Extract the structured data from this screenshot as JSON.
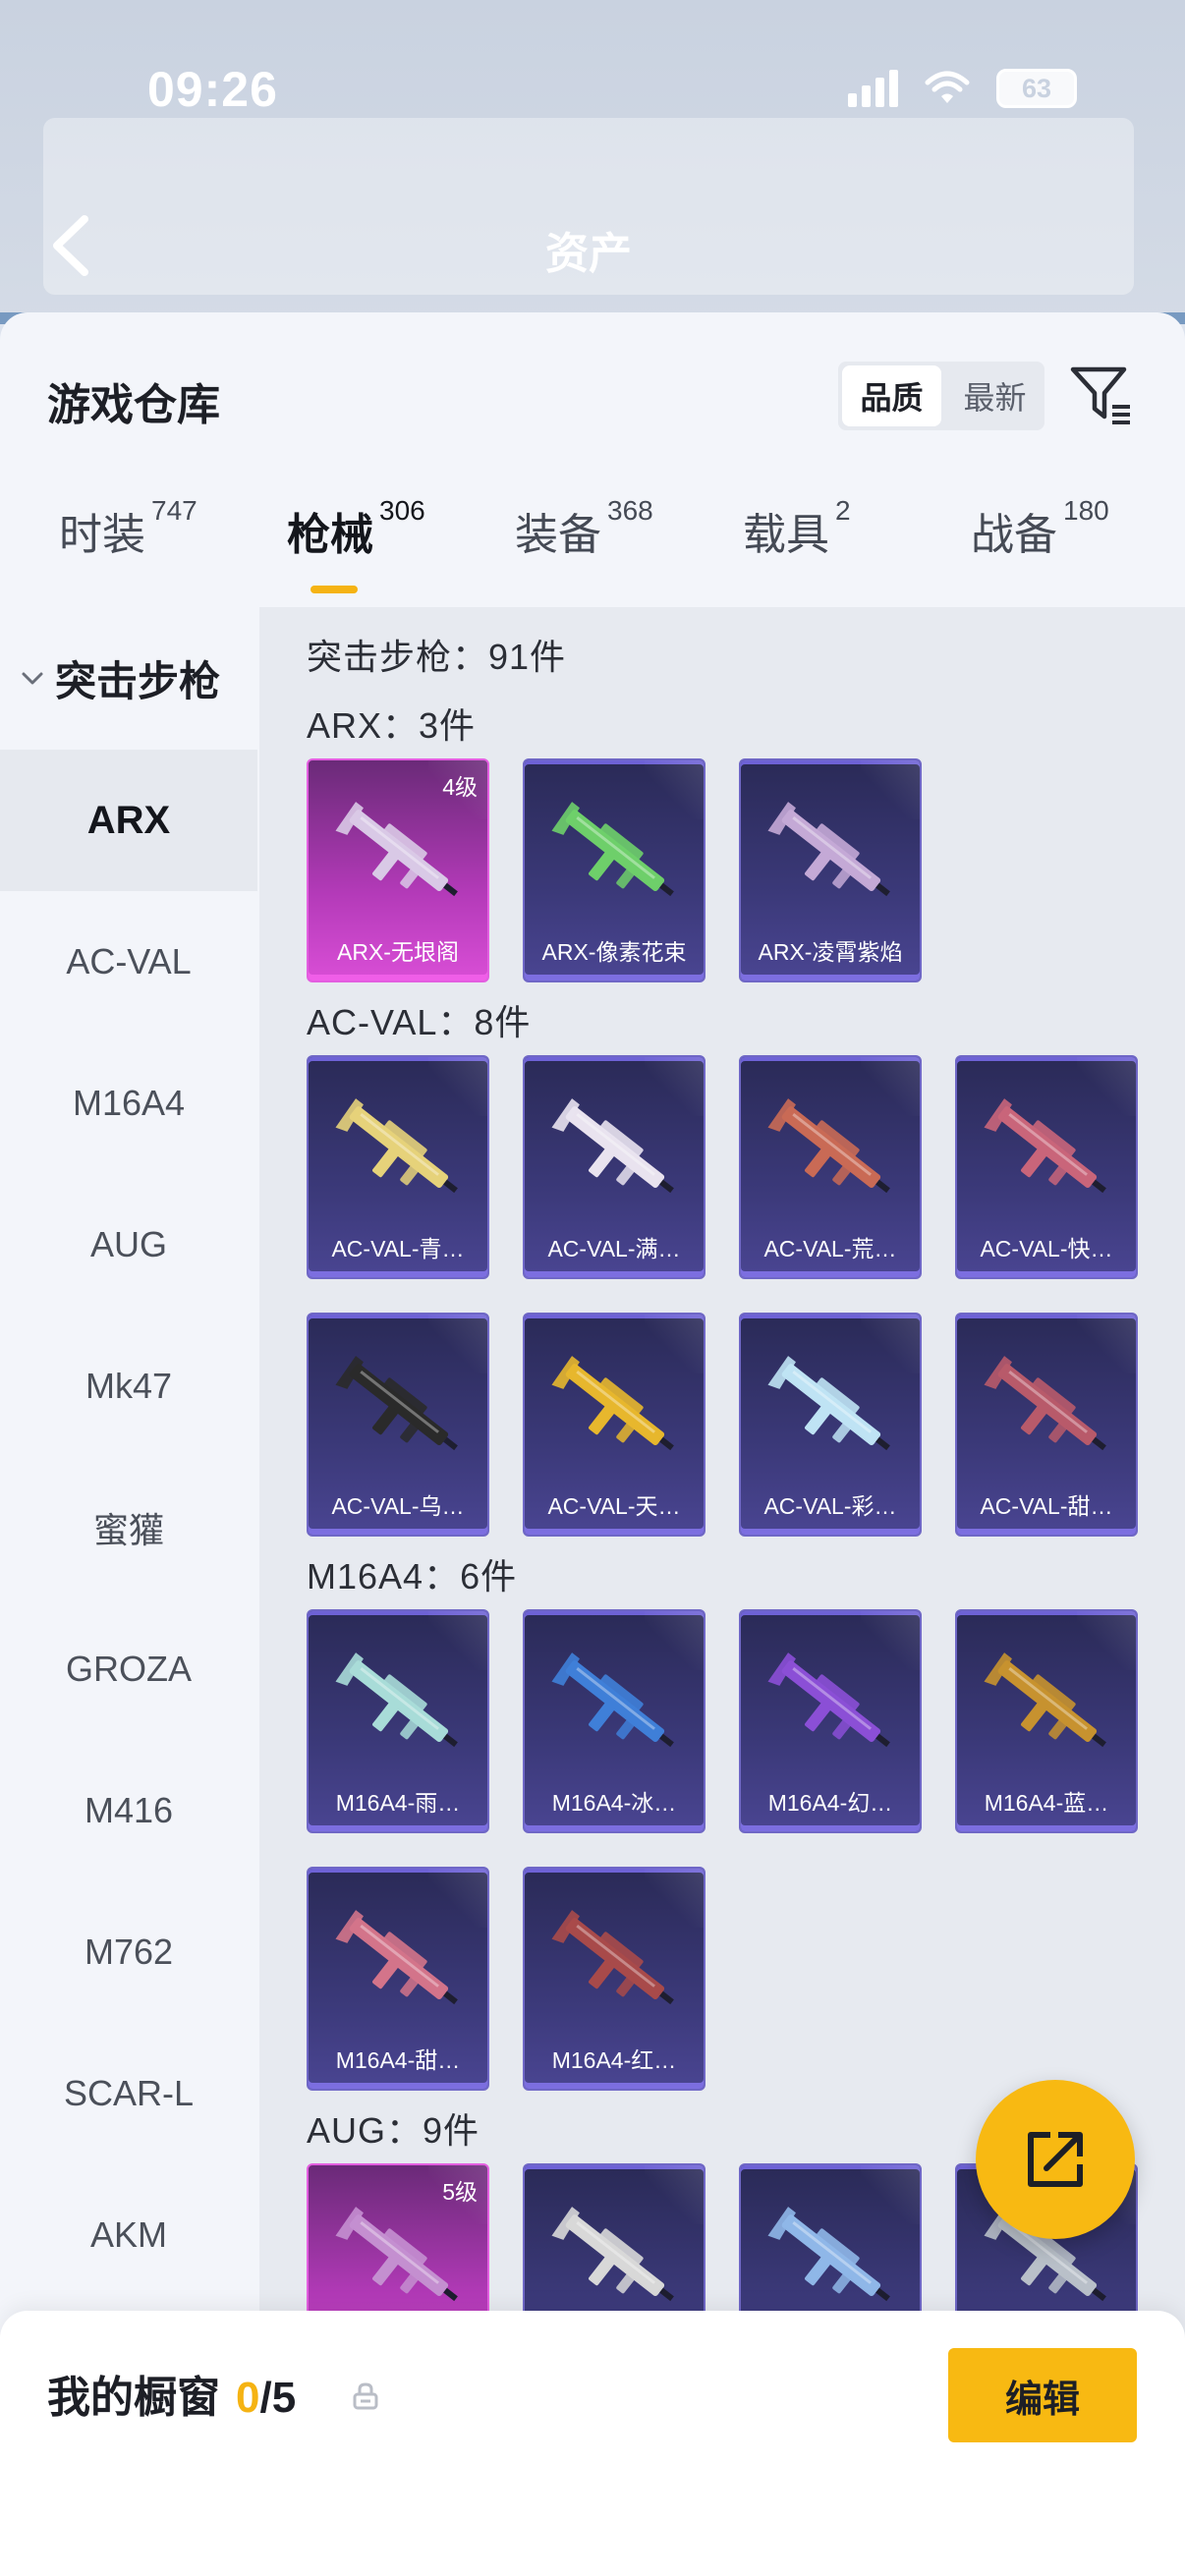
{
  "status_bar": {
    "time": "09:26",
    "battery": "63"
  },
  "header": {
    "title": "资产"
  },
  "sheet": {
    "title": "游戏仓库",
    "sort": [
      {
        "label": "品质",
        "active": true
      },
      {
        "label": "最新",
        "active": false
      }
    ]
  },
  "tabs": [
    {
      "label": "时装",
      "count": "747"
    },
    {
      "label": "枪械",
      "count": "306"
    },
    {
      "label": "装备",
      "count": "368"
    },
    {
      "label": "载具",
      "count": "2"
    },
    {
      "label": "战备",
      "count": "180"
    }
  ],
  "sidebar": {
    "category": "突击步枪",
    "items": [
      "ARX",
      "AC-VAL",
      "M16A4",
      "AUG",
      "Mk47",
      "蜜獾",
      "GROZA",
      "M416",
      "M762",
      "SCAR-L",
      "AKM"
    ]
  },
  "content": {
    "category_total": "突击步枪：91件",
    "sections": [
      {
        "title": "ARX：3件",
        "items": [
          {
            "name": "ARX-无垠阁",
            "level": "4级",
            "rarity": "legendary",
            "color": "#d9c9e6"
          },
          {
            "name": "ARX-像素花束",
            "level": "",
            "rarity": "epic",
            "color": "#6ecf6a"
          },
          {
            "name": "ARX-凌霄紫焰",
            "level": "",
            "rarity": "epic",
            "color": "#c4a9d6"
          }
        ]
      },
      {
        "title": "AC-VAL：8件",
        "items": [
          {
            "name": "AC-VAL-青…",
            "level": "",
            "rarity": "epic",
            "color": "#e6d27a"
          },
          {
            "name": "AC-VAL-满…",
            "level": "",
            "rarity": "epic",
            "color": "#e9e3ef"
          },
          {
            "name": "AC-VAL-荒…",
            "level": "",
            "rarity": "epic",
            "color": "#c96a55"
          },
          {
            "name": "AC-VAL-快…",
            "level": "",
            "rarity": "epic",
            "color": "#c9657a"
          },
          {
            "name": "AC-VAL-乌…",
            "level": "",
            "rarity": "epic",
            "color": "#2a2a2a"
          },
          {
            "name": "AC-VAL-天…",
            "level": "",
            "rarity": "epic",
            "color": "#e7b72d"
          },
          {
            "name": "AC-VAL-彩…",
            "level": "",
            "rarity": "epic",
            "color": "#bfe3f4"
          },
          {
            "name": "AC-VAL-甜…",
            "level": "",
            "rarity": "epic",
            "color": "#b85a6a"
          }
        ]
      },
      {
        "title": "M16A4：6件",
        "items": [
          {
            "name": "M16A4-雨…",
            "level": "",
            "rarity": "epic",
            "color": "#a8dcd8"
          },
          {
            "name": "M16A4-冰…",
            "level": "",
            "rarity": "epic",
            "color": "#3f7fd8"
          },
          {
            "name": "M16A4-幻…",
            "level": "",
            "rarity": "epic",
            "color": "#8b4fd6"
          },
          {
            "name": "M16A4-蓝…",
            "level": "",
            "rarity": "epic",
            "color": "#c7922f"
          },
          {
            "name": "M16A4-甜…",
            "level": "",
            "rarity": "epic",
            "color": "#d3748a"
          },
          {
            "name": "M16A4-红…",
            "level": "",
            "rarity": "epic",
            "color": "#a84a4a"
          }
        ]
      },
      {
        "title": "AUG：9件",
        "items": [
          {
            "name": "",
            "level": "5级",
            "rarity": "legendary",
            "color": "#c48fd0"
          },
          {
            "name": "",
            "level": "",
            "rarity": "epic",
            "color": "#d8d8d8"
          },
          {
            "name": "",
            "level": "",
            "rarity": "epic",
            "color": "#8fb7e8"
          },
          {
            "name": "",
            "level": "",
            "rarity": "epic",
            "color": "#b9c0c9"
          }
        ]
      }
    ]
  },
  "showcase": {
    "title": "我的橱窗",
    "current": "0",
    "separator": "/",
    "max": "5",
    "edit_label": "编辑"
  }
}
